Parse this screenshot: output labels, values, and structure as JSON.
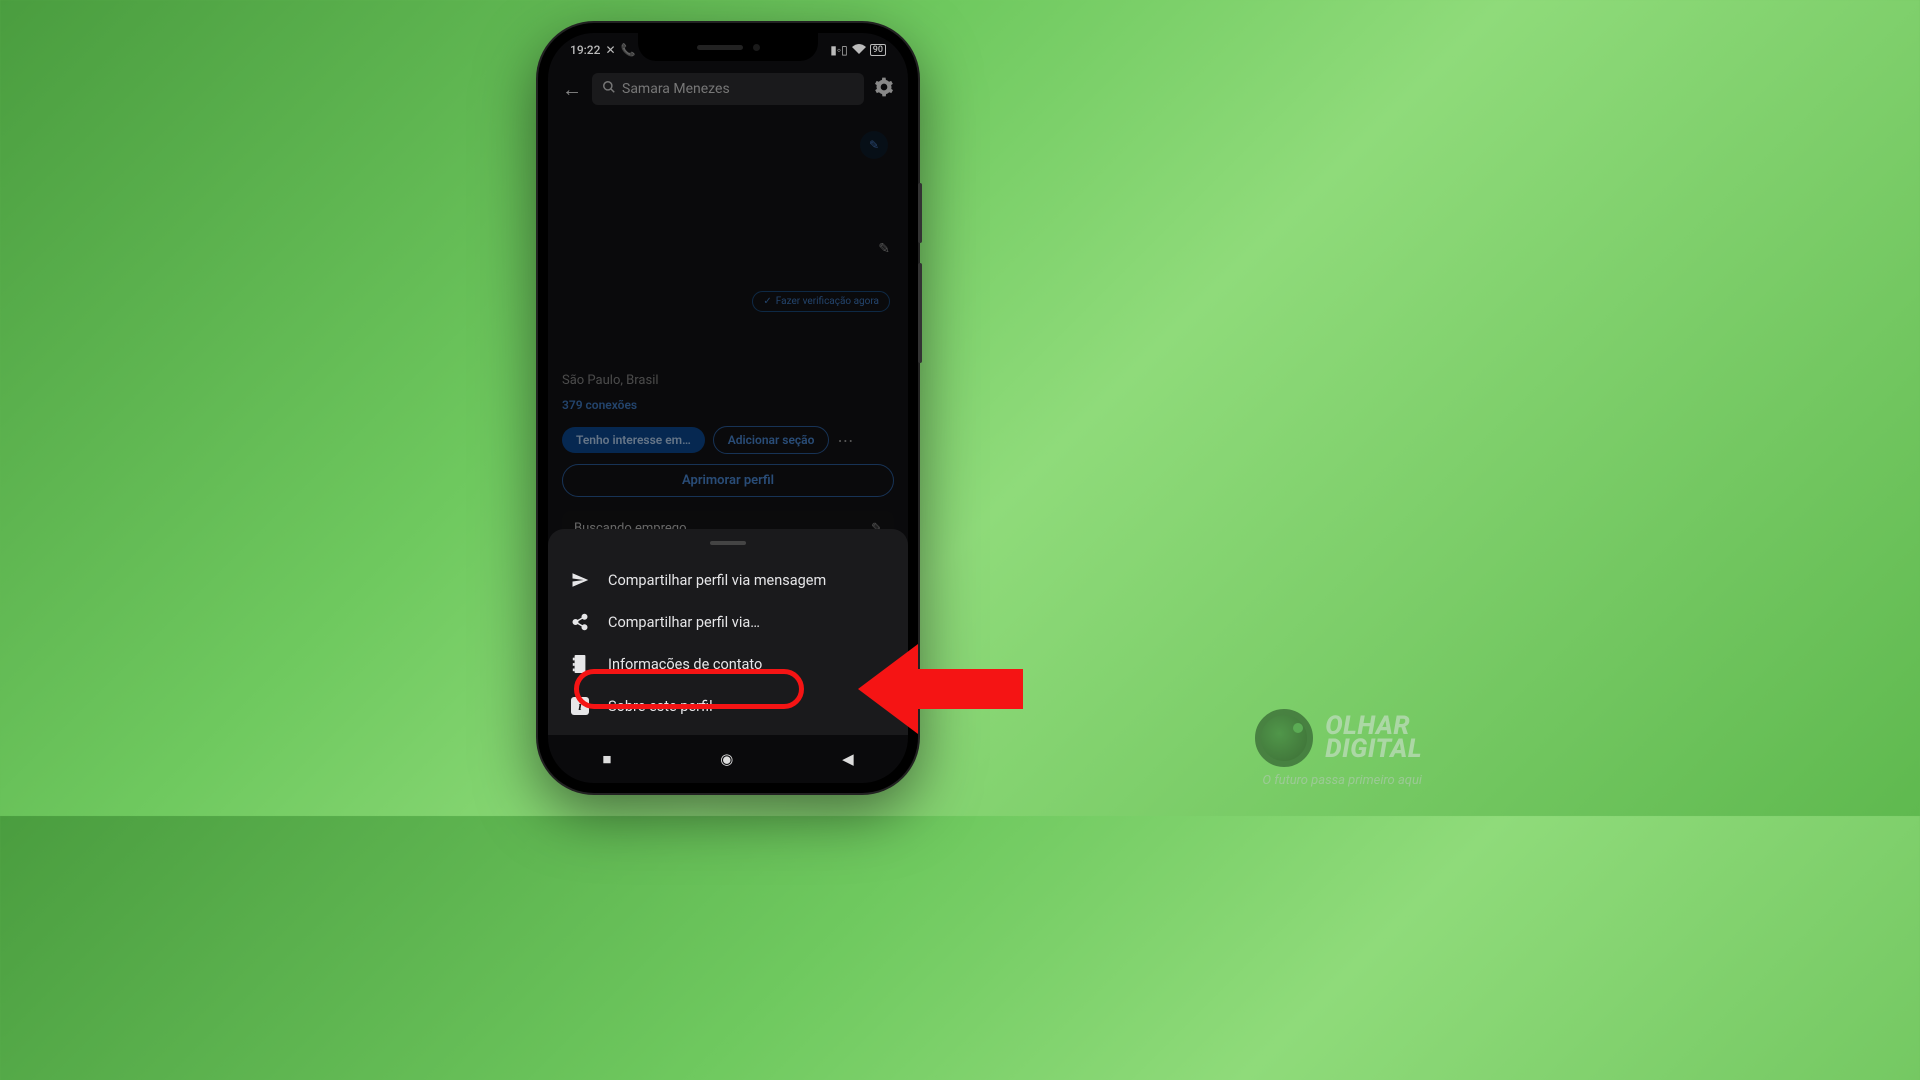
{
  "status": {
    "time": "19:22",
    "battery": "90"
  },
  "header": {
    "search_value": "Samara Menezes"
  },
  "profile": {
    "verify_label": "Fazer verificação agora",
    "location": "São Paulo, Brasil",
    "connections": "379 conexões",
    "btn_interest": "Tenho interesse em…",
    "btn_add_section": "Adicionar seção",
    "btn_improve": "Aprimorar perfil",
    "job_search_label": "Buscando emprego"
  },
  "menu": {
    "items": [
      {
        "icon": "send",
        "label": "Compartilhar perfil via mensagem"
      },
      {
        "icon": "share",
        "label": "Compartilhar perfil via…"
      },
      {
        "icon": "book",
        "label": "Informações de contato"
      },
      {
        "icon": "info",
        "label": "Sobre este perfil"
      }
    ]
  },
  "brand": {
    "line1": "OLHAR",
    "line2": "DIGITAL",
    "tagline": "O futuro passa primeiro aqui"
  }
}
